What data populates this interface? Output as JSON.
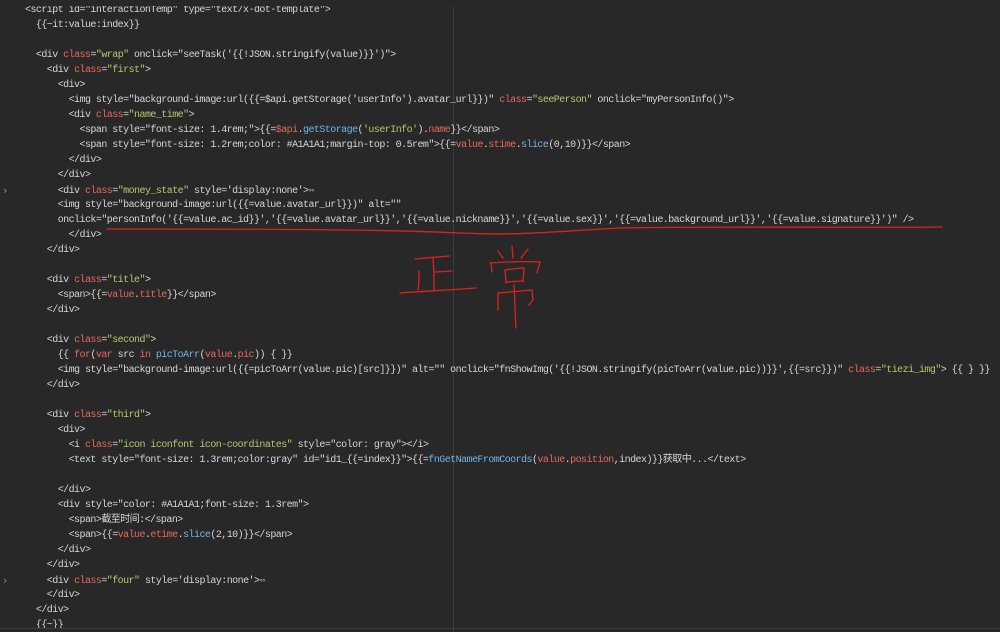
{
  "editor": {
    "theme": {
      "background": "#282828",
      "text": "#d6d6d6",
      "attr": "#e8685d",
      "str": "#b8c76c",
      "fn": "#72b4e8",
      "var": "#e8685d",
      "kw": "#e8685d",
      "fold": "#a0a0a0",
      "ruler": "#3c3c3c",
      "gutter": "#8c8c8c",
      "annotation": "#e02020"
    },
    "gutter": {
      "fold_icon": "chevron-right-icon",
      "fold_glyph": "›"
    },
    "lines": [
      {
        "segs": [
          [
            "p",
            "<script id=\"interactionTemp\" type=\"text/x-dot-template\">"
          ]
        ]
      },
      {
        "segs": [
          [
            "p",
            "  {{~it:value:index}}"
          ]
        ]
      },
      {
        "segs": []
      },
      {
        "segs": [
          [
            "p",
            "  <div "
          ],
          [
            "attr",
            "class"
          ],
          [
            "p",
            "="
          ],
          [
            "str",
            "\"wrap\""
          ],
          [
            "p",
            " onclick=\"seeTask('{{!JSON.stringify(value)}}')\">"
          ]
        ]
      },
      {
        "segs": [
          [
            "p",
            "    <div "
          ],
          [
            "attr",
            "class"
          ],
          [
            "p",
            "="
          ],
          [
            "str",
            "\"first\""
          ],
          [
            "p",
            ">"
          ]
        ]
      },
      {
        "segs": [
          [
            "p",
            "      <div>"
          ]
        ]
      },
      {
        "segs": [
          [
            "p",
            "        <img style=\"background-image:url({{=$api.getStorage('userInfo').avatar_url}})\" "
          ],
          [
            "attr",
            "class"
          ],
          [
            "p",
            "="
          ],
          [
            "str",
            "\"seePerson\""
          ],
          [
            "p",
            " onclick=\"myPersonInfo()\">"
          ]
        ]
      },
      {
        "segs": [
          [
            "p",
            "        <div "
          ],
          [
            "attr",
            "class"
          ],
          [
            "p",
            "="
          ],
          [
            "str",
            "\"name_time\""
          ],
          [
            "p",
            ">"
          ]
        ]
      },
      {
        "segs": [
          [
            "p",
            "          <span style=\"font-size: 1.4rem;\">{{="
          ],
          [
            "var",
            "$api"
          ],
          [
            "p",
            "."
          ],
          [
            "fn",
            "getStorage"
          ],
          [
            "p",
            "("
          ],
          [
            "str",
            "'userInfo'"
          ],
          [
            "p",
            ")."
          ],
          [
            "var",
            "name"
          ],
          [
            "p",
            "}}</span>"
          ]
        ]
      },
      {
        "segs": [
          [
            "p",
            "          <span style=\"font-size: 1.2rem;color: #A1A1A1;margin-top: 0.5rem\">{{="
          ],
          [
            "var",
            "value"
          ],
          [
            "p",
            "."
          ],
          [
            "var",
            "stime"
          ],
          [
            "p",
            "."
          ],
          [
            "fn",
            "slice"
          ],
          [
            "p",
            "(0,10)}}</span>"
          ]
        ]
      },
      {
        "segs": [
          [
            "p",
            "        </div>"
          ]
        ]
      },
      {
        "segs": [
          [
            "p",
            "      </div>"
          ]
        ]
      },
      {
        "fold": true,
        "segs": [
          [
            "p",
            "      <div "
          ],
          [
            "attr",
            "class"
          ],
          [
            "p",
            "="
          ],
          [
            "str",
            "\"money_state\""
          ],
          [
            "p",
            " style='display:none'>"
          ],
          [
            "fold",
            "⇔"
          ]
        ]
      },
      {
        "segs": [
          [
            "p",
            "      <img style=\"background-image:url({{=value.avatar_url}})\" alt=\"\""
          ]
        ]
      },
      {
        "segs": [
          [
            "p",
            "      onclick=\"personInfo('{{=value.ac_id}}','{{=value.avatar_url}}','{{=value.nickname}}','{{=value.sex}}','{{=value.background_url}}','{{=value.signature}}')\" />"
          ]
        ]
      },
      {
        "segs": [
          [
            "p",
            "        </div>"
          ]
        ]
      },
      {
        "segs": [
          [
            "p",
            "    </div>"
          ]
        ]
      },
      {
        "segs": []
      },
      {
        "segs": [
          [
            "p",
            "    <div "
          ],
          [
            "attr",
            "class"
          ],
          [
            "p",
            "="
          ],
          [
            "str",
            "\"title\""
          ],
          [
            "p",
            ">"
          ]
        ]
      },
      {
        "segs": [
          [
            "p",
            "      <span>{{="
          ],
          [
            "var",
            "value"
          ],
          [
            "p",
            "."
          ],
          [
            "var",
            "title"
          ],
          [
            "p",
            "}}</span>"
          ]
        ]
      },
      {
        "segs": [
          [
            "p",
            "    </div>"
          ]
        ]
      },
      {
        "segs": []
      },
      {
        "segs": [
          [
            "p",
            "    <div "
          ],
          [
            "attr",
            "class"
          ],
          [
            "p",
            "="
          ],
          [
            "str",
            "\"second\""
          ],
          [
            "p",
            ">"
          ]
        ]
      },
      {
        "segs": [
          [
            "p",
            "      {{ "
          ],
          [
            "kw",
            "for"
          ],
          [
            "p",
            "("
          ],
          [
            "kw",
            "var"
          ],
          [
            "p",
            " src "
          ],
          [
            "kw",
            "in"
          ],
          [
            "p",
            " "
          ],
          [
            "fn",
            "picToArr"
          ],
          [
            "p",
            "("
          ],
          [
            "var",
            "value"
          ],
          [
            "p",
            "."
          ],
          [
            "var",
            "pic"
          ],
          [
            "p",
            ")) { }}"
          ]
        ]
      },
      {
        "segs": [
          [
            "p",
            "      <img style=\"background-image:url({{=picToArr(value.pic)[src]}})\" alt=\"\" onclick=\"fnShowImg('{{!JSON.stringify(picToArr(value.pic))}}',{{=src}})\" "
          ],
          [
            "attr",
            "class"
          ],
          [
            "p",
            "="
          ],
          [
            "str",
            "\"tiezi_img\""
          ],
          [
            "p",
            "> {{ } }}"
          ]
        ]
      },
      {
        "segs": [
          [
            "p",
            "    </div>"
          ]
        ]
      },
      {
        "segs": []
      },
      {
        "segs": [
          [
            "p",
            "    <div "
          ],
          [
            "attr",
            "class"
          ],
          [
            "p",
            "="
          ],
          [
            "str",
            "\"third\""
          ],
          [
            "p",
            ">"
          ]
        ]
      },
      {
        "segs": [
          [
            "p",
            "      <div>"
          ]
        ]
      },
      {
        "segs": [
          [
            "p",
            "        <i "
          ],
          [
            "attr",
            "class"
          ],
          [
            "p",
            "="
          ],
          [
            "str",
            "\"icon iconfont icon-coordinates\""
          ],
          [
            "p",
            " style=\"color: gray\"></i>"
          ]
        ]
      },
      {
        "segs": [
          [
            "p",
            "        <text style=\"font-size: 1.3rem;color:gray\" id=\"id1_{{=index}}\">{{="
          ],
          [
            "fn",
            "fnGetNameFromCoords"
          ],
          [
            "p",
            "("
          ],
          [
            "var",
            "value"
          ],
          [
            "p",
            "."
          ],
          [
            "var",
            "position"
          ],
          [
            "p",
            ",index)}}获取中...</text>"
          ]
        ]
      },
      {
        "segs": []
      },
      {
        "segs": [
          [
            "p",
            "      </div>"
          ]
        ]
      },
      {
        "segs": [
          [
            "p",
            "      <div style=\"color: #A1A1A1;font-size: 1.3rem\">"
          ]
        ]
      },
      {
        "segs": [
          [
            "p",
            "        <span>截至时间:</span>"
          ]
        ]
      },
      {
        "segs": [
          [
            "p",
            "        <span>{{="
          ],
          [
            "var",
            "value"
          ],
          [
            "p",
            "."
          ],
          [
            "var",
            "etime"
          ],
          [
            "p",
            "."
          ],
          [
            "fn",
            "slice"
          ],
          [
            "p",
            "(2,10)}}</span>"
          ]
        ]
      },
      {
        "segs": [
          [
            "p",
            "      </div>"
          ]
        ]
      },
      {
        "segs": [
          [
            "p",
            "    </div>"
          ]
        ]
      },
      {
        "fold": true,
        "segs": [
          [
            "p",
            "    <div "
          ],
          [
            "attr",
            "class"
          ],
          [
            "p",
            "="
          ],
          [
            "str",
            "\"four\""
          ],
          [
            "p",
            " style='display:none'>"
          ],
          [
            "fold",
            "⇔"
          ]
        ]
      },
      {
        "segs": [
          [
            "p",
            "    </div>"
          ]
        ]
      },
      {
        "segs": [
          [
            "p",
            "  </div>"
          ]
        ]
      },
      {
        "segs": [
          [
            "p",
            "  {{~}}"
          ]
        ]
      }
    ]
  },
  "annotation": {
    "text": "正常"
  }
}
